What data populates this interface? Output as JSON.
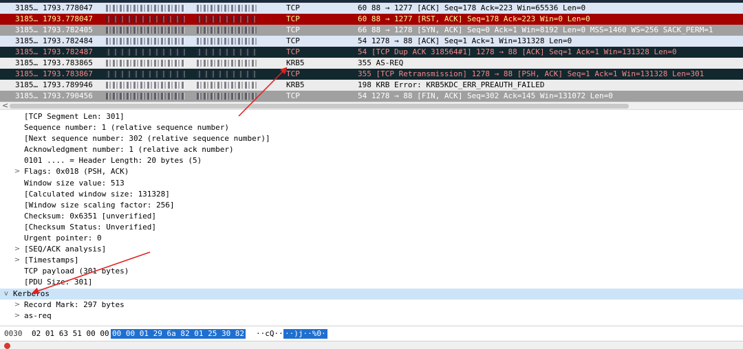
{
  "packets": [
    {
      "no": "3185…",
      "time": "1793.778047",
      "src": "192.168.38.144",
      "dst": "192.168.38.144",
      "proto": "TCP",
      "info": "60 88 → 1277 [ACK] Seq=178 Ack=223 Win=65536 Len=0",
      "bg": "#dde6f4",
      "fg": "#000000"
    },
    {
      "no": "3185…",
      "time": "1793.778047",
      "src": "192.168.38.144",
      "dst": "192.168.38.141",
      "proto": "TCP",
      "info": "60 88 → 1277 [RST, ACK] Seq=178 Ack=223 Win=0 Len=0",
      "bg": "#a40000",
      "fg": "#fffc9c"
    },
    {
      "no": "3185…",
      "time": "1793.782405",
      "src": "192.168.38.144",
      "dst": "192.168.38.144",
      "proto": "TCP",
      "info": "66 88 → 1278 [SYN, ACK] Seq=0 Ack=1 Win=8192 Len=0 MSS=1460 WS=256 SACK_PERM=1",
      "bg": "#a0a0a0",
      "fg": "#ffffff"
    },
    {
      "no": "3185…",
      "time": "1793.782484",
      "src": "192.168.38.144",
      "dst": "192.168.38.144",
      "proto": "TCP",
      "info": "54 1278 → 88 [ACK] Seq=1 Ack=1 Win=131328 Len=0",
      "bg": "#dde6f4",
      "fg": "#000000"
    },
    {
      "no": "3185…",
      "time": "1793.782487",
      "src": "192.168.38.144",
      "dst": "192.168.38.144",
      "proto": "TCP",
      "info": "54 [TCP Dup ACK 318564#1] 1278 → 88 [ACK] Seq=1 Ack=1 Win=131328 Len=0",
      "bg": "#12272e",
      "fg": "#f78787"
    },
    {
      "no": "3185…",
      "time": "1793.783865",
      "src": "192.168.38.144",
      "dst": "192.168.38.144",
      "proto": "KRB5",
      "info": "355 AS-REQ",
      "bg": "#ececec",
      "fg": "#000000"
    },
    {
      "no": "3185…",
      "time": "1793.783867",
      "src": "192.168.38.144",
      "dst": "192.168.38.143",
      "proto": "TCP",
      "info": "355 [TCP Retransmission] 1278 → 88 [PSH, ACK] Seq=1 Ack=1 Win=131328 Len=301",
      "bg": "#12272e",
      "fg": "#f78787"
    },
    {
      "no": "3185…",
      "time": "1793.789946",
      "src": "192.168.38.144",
      "dst": "192.168.38.144",
      "proto": "KRB5",
      "info": "198 KRB Error: KRB5KDC_ERR_PREAUTH_FAILED",
      "bg": "#ececec",
      "fg": "#000000"
    },
    {
      "no": "3185…",
      "time": "1793.790456",
      "src": "192.168.38.144",
      "dst": "192.168.38.144",
      "proto": "TCP",
      "info": "54 1278 → 88 [FIN, ACK] Seq=302 Ack=145 Win=131072 Len=0",
      "bg": "#a0a0a0",
      "fg": "#ffffff"
    }
  ],
  "scroll": {
    "left_arrow": "<"
  },
  "details": [
    {
      "text": "[TCP Segment Len: 301]",
      "level": 1,
      "expander": ""
    },
    {
      "text": "Sequence number: 1    (relative sequence number)",
      "level": 1,
      "expander": ""
    },
    {
      "text": "[Next sequence number: 302    (relative sequence number)]",
      "level": 1,
      "expander": ""
    },
    {
      "text": "Acknowledgment number: 1    (relative ack number)",
      "level": 1,
      "expander": ""
    },
    {
      "text": "0101 .... = Header Length: 20 bytes (5)",
      "level": 1,
      "expander": ""
    },
    {
      "text": "Flags: 0x018 (PSH, ACK)",
      "level": 1,
      "expander": ">"
    },
    {
      "text": "Window size value: 513",
      "level": 1,
      "expander": ""
    },
    {
      "text": "[Calculated window size: 131328]",
      "level": 1,
      "expander": ""
    },
    {
      "text": "[Window size scaling factor: 256]",
      "level": 1,
      "expander": ""
    },
    {
      "text": "Checksum: 0x6351 [unverified]",
      "level": 1,
      "expander": ""
    },
    {
      "text": "[Checksum Status: Unverified]",
      "level": 1,
      "expander": ""
    },
    {
      "text": "Urgent pointer: 0",
      "level": 1,
      "expander": ""
    },
    {
      "text": "[SEQ/ACK analysis]",
      "level": 1,
      "expander": ">"
    },
    {
      "text": "[Timestamps]",
      "level": 1,
      "expander": ">"
    },
    {
      "text": "TCP payload (301 bytes)",
      "level": 1,
      "expander": ""
    },
    {
      "text": "[PDU Size: 301]",
      "level": 1,
      "expander": ""
    },
    {
      "text": "Kerberos",
      "level": 0,
      "expander": "v",
      "selected": true
    },
    {
      "text": "Record Mark: 297 bytes",
      "level": 1,
      "expander": ">"
    },
    {
      "text": "as-req",
      "level": 1,
      "expander": ">"
    }
  ],
  "hex": {
    "offset": "0030",
    "bytes_plain": "02 01 63 51 00 00",
    "bytes_selected": "00 00  01 29 6a 82 01 25 30 82",
    "ascii_plain": "··cQ··",
    "ascii_selected": "··)j··%0·"
  },
  "colors": {
    "selection": "#cce4f7",
    "hex_highlight": "#1f6fd1",
    "arrow": "#e02020"
  }
}
